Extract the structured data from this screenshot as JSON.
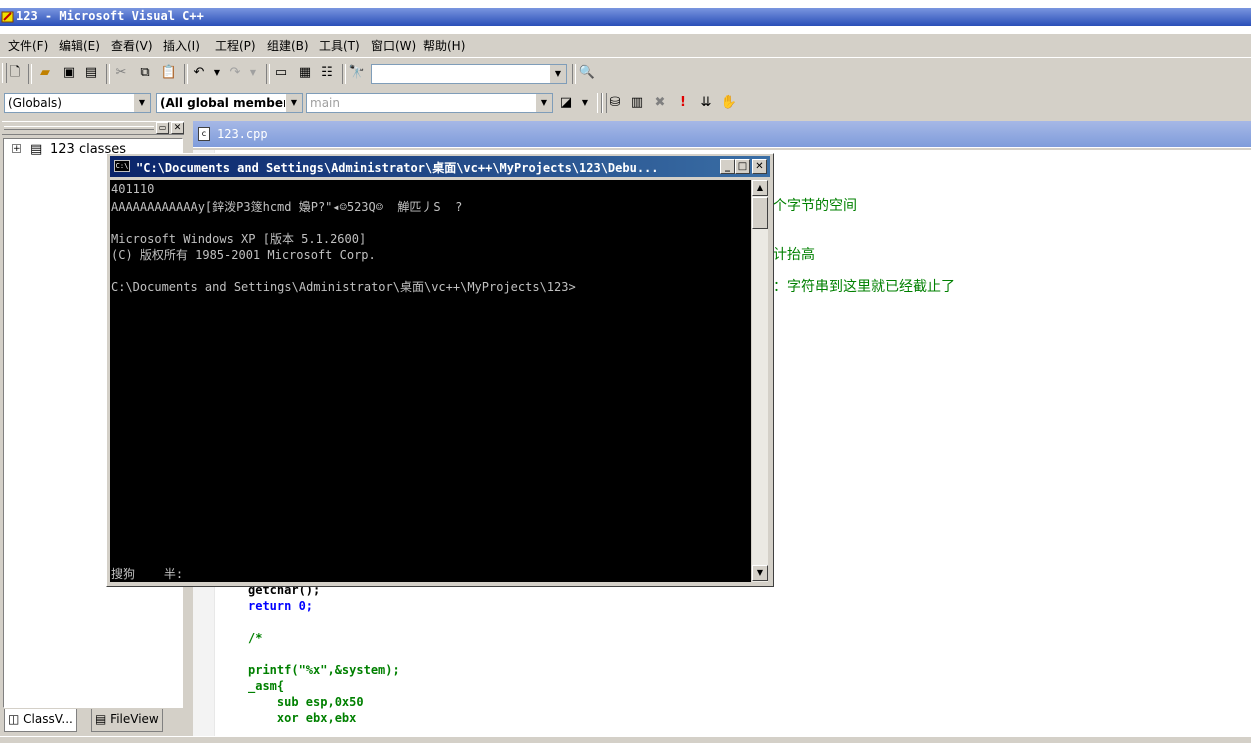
{
  "app": {
    "title": "123 - Microsoft Visual C++"
  },
  "menu": {
    "items": [
      "文件(F)",
      "编辑(E)",
      "查看(V)",
      "插入(I)",
      "工程(P)",
      "组建(B)",
      "工具(T)",
      "窗口(W)",
      "帮助(H)"
    ]
  },
  "toolbar2": {
    "globals_combo": "(Globals)",
    "members_combo": "(All global member",
    "function_combo": "main"
  },
  "workspace": {
    "tree_root": "123 classes",
    "tab_classview": "ClassV...",
    "tab_fileview": "FileView"
  },
  "editor": {
    "file_title": "123.cpp",
    "visible_comment_1": "个字节的空间",
    "visible_comment_2": "计抬高",
    "visible_comment_3": "：字符串到这里就已经截止了",
    "code_line_1": "getchar();",
    "code_line_2": "return 0;",
    "code_line_3": "/*",
    "code_line_4": "printf(\"%x\",&system);",
    "code_line_5": "_asm{",
    "code_line_6": "    sub esp,0x50",
    "code_line_7": "    xor ebx,ebx"
  },
  "console": {
    "title": "\"C:\\Documents and Settings\\Administrator\\桌面\\vc++\\MyProjects\\123\\Debu...",
    "lines": [
      "401110",
      "AAAAAAAAAAAAy[鋅泼P3篴hcmd 嬝P?\"◂☺523Q☺  觯匹丿S  ?",
      "",
      "Microsoft Windows XP [版本 5.1.2600]",
      "(C) 版权所有 1985-2001 Microsoft Corp.",
      "",
      "C:\\Documents and Settings\\Administrator\\桌面\\vc++\\MyProjects\\123>"
    ],
    "ime_status": "搜狗    半:"
  },
  "colors": {
    "title_active": "#0a246a",
    "editor_comment": "#008000",
    "editor_keyword": "#0000ff"
  }
}
